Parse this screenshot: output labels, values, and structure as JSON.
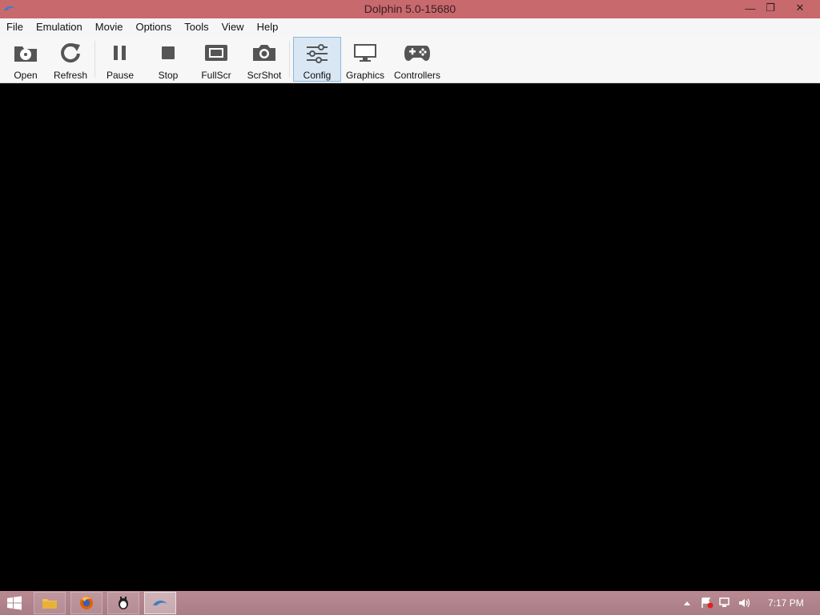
{
  "window": {
    "title": "Dolphin 5.0-15680",
    "controls": {
      "minimize": "—",
      "restore": "❐",
      "close": "✕"
    }
  },
  "menubar": {
    "items": [
      "File",
      "Emulation",
      "Movie",
      "Options",
      "Tools",
      "View",
      "Help"
    ]
  },
  "toolbar": {
    "buttons": [
      {
        "label": "Open",
        "icon": "disc-icon"
      },
      {
        "label": "Refresh",
        "icon": "refresh-icon"
      },
      {
        "label": "Pause",
        "icon": "pause-icon"
      },
      {
        "label": "Stop",
        "icon": "stop-icon"
      },
      {
        "label": "FullScr",
        "icon": "fullscreen-icon"
      },
      {
        "label": "ScrShot",
        "icon": "camera-icon"
      },
      {
        "label": "Config",
        "icon": "sliders-icon",
        "selected": true
      },
      {
        "label": "Graphics",
        "icon": "monitor-icon"
      },
      {
        "label": "Controllers",
        "icon": "gamepad-icon"
      }
    ]
  },
  "taskbar": {
    "clock": "7:17 PM",
    "apps": [
      "file-explorer-icon",
      "firefox-icon",
      "app-icon",
      "dolphin-icon"
    ]
  },
  "colors": {
    "titlebar": "#c8696e",
    "selected_bg": "#d9e7f5",
    "render_bg": "#000000"
  }
}
